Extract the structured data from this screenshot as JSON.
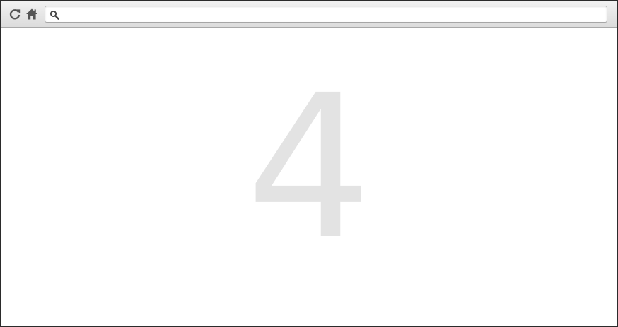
{
  "toolbar": {
    "reload_icon": "reload-icon",
    "home_icon": "home-icon",
    "search_icon": "search-icon",
    "address_value": "",
    "address_placeholder": ""
  },
  "content": {
    "big_number": "4"
  },
  "colors": {
    "toolbar_top": "#f2f2f2",
    "toolbar_bottom": "#dcdcdc",
    "icon": "#555555",
    "number": "#e3e3e3"
  }
}
